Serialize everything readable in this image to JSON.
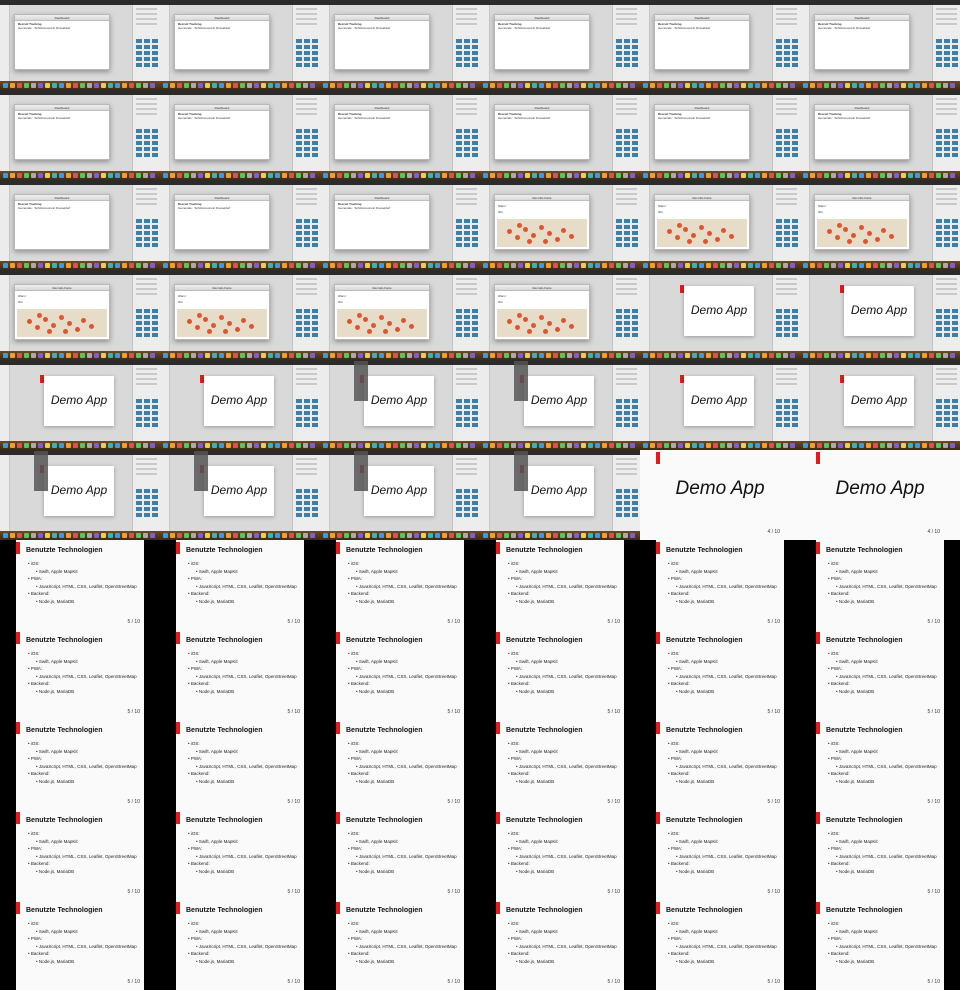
{
  "dashboard_window": {
    "title": "Dashboard",
    "heading": "Recruit Tracking",
    "line": "Gemeinde · Schützenverein Dusseldorf"
  },
  "map_window": {
    "title": "Recruits Karte",
    "route_from_label": "Wann:",
    "route_to_label": "Wo:"
  },
  "slides": {
    "demo": {
      "title": "Demo App",
      "page": "4 / 10"
    },
    "tech": {
      "title": "Benutzte Technologien",
      "ios_label": "iOS:",
      "ios_detail": "Swift, Apple MapKit",
      "pwa_label": "PWA:",
      "pwa_detail": "JavaScript, HTML, CSS, Leaflet, OpenStreetMap",
      "backend_label": "Backend:",
      "backend_detail": "Node.js, MariaDB",
      "page": "5 / 10"
    }
  },
  "grid_cells": [
    "dashboard",
    "dashboard",
    "dashboard",
    "dashboard",
    "dashboard",
    "dashboard",
    "dashboard",
    "dashboard",
    "dashboard",
    "dashboard",
    "dashboard",
    "dashboard",
    "dashboard",
    "dashboard",
    "dashboard",
    "map",
    "map",
    "map",
    "map",
    "map",
    "map",
    "map",
    "demo-desktop",
    "demo-desktop",
    "demo-desktop",
    "demo-desktop",
    "demo-desktop-popup",
    "demo-desktop-popup",
    "demo-desktop",
    "demo-desktop",
    "demo-desktop-popup",
    "demo-desktop-popup",
    "demo-desktop-popup",
    "demo-desktop-popup",
    "demo-slide",
    "demo-slide",
    "tech",
    "tech",
    "tech",
    "tech",
    "tech",
    "tech",
    "tech",
    "tech",
    "tech",
    "tech",
    "tech",
    "tech",
    "tech",
    "tech",
    "tech",
    "tech",
    "tech",
    "tech",
    "tech",
    "tech",
    "tech",
    "tech",
    "tech",
    "tech",
    "tech",
    "tech",
    "tech",
    "tech",
    "tech",
    "tech"
  ],
  "colors": {
    "accent_red": "#e31b1b",
    "map_pin": "#e2542c",
    "dock_tile": "#3e7fa8"
  }
}
